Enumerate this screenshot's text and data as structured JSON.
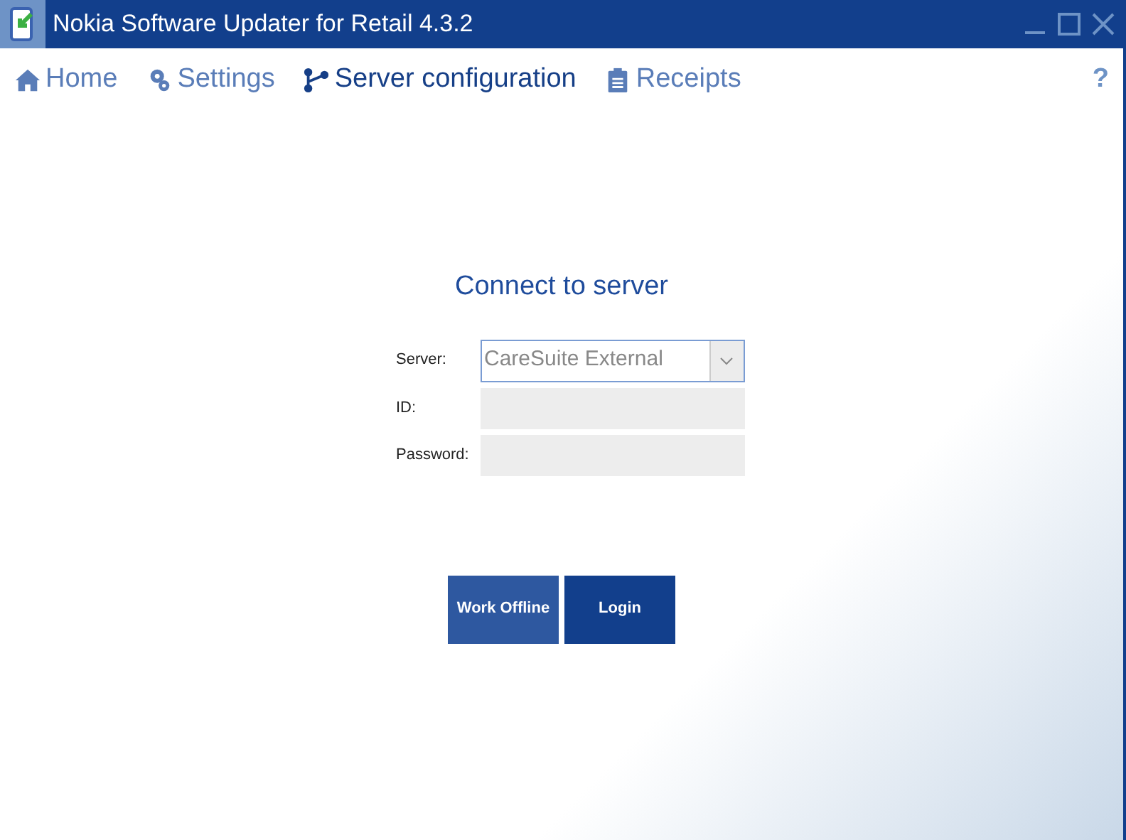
{
  "window": {
    "title": "Nokia Software Updater for Retail 4.3.2"
  },
  "nav": [
    {
      "label": "Home",
      "kind": "home",
      "selected": false
    },
    {
      "label": "Settings",
      "kind": "settings",
      "selected": false
    },
    {
      "label": "Server configuration",
      "kind": "server",
      "selected": true
    },
    {
      "label": "Receipts",
      "kind": "receipts",
      "selected": false
    }
  ],
  "help": "?",
  "form": {
    "heading": "Connect to server",
    "fields": [
      {
        "label": "Server:",
        "kind": "dropdown",
        "value": "CareSuite External"
      },
      {
        "label": "ID:",
        "kind": "text"
      },
      {
        "label": "Password:",
        "kind": "password"
      }
    ]
  },
  "buttons": [
    {
      "label": "Work Offline",
      "kind": "secondary"
    },
    {
      "label": "Login",
      "kind": "primary"
    }
  ]
}
